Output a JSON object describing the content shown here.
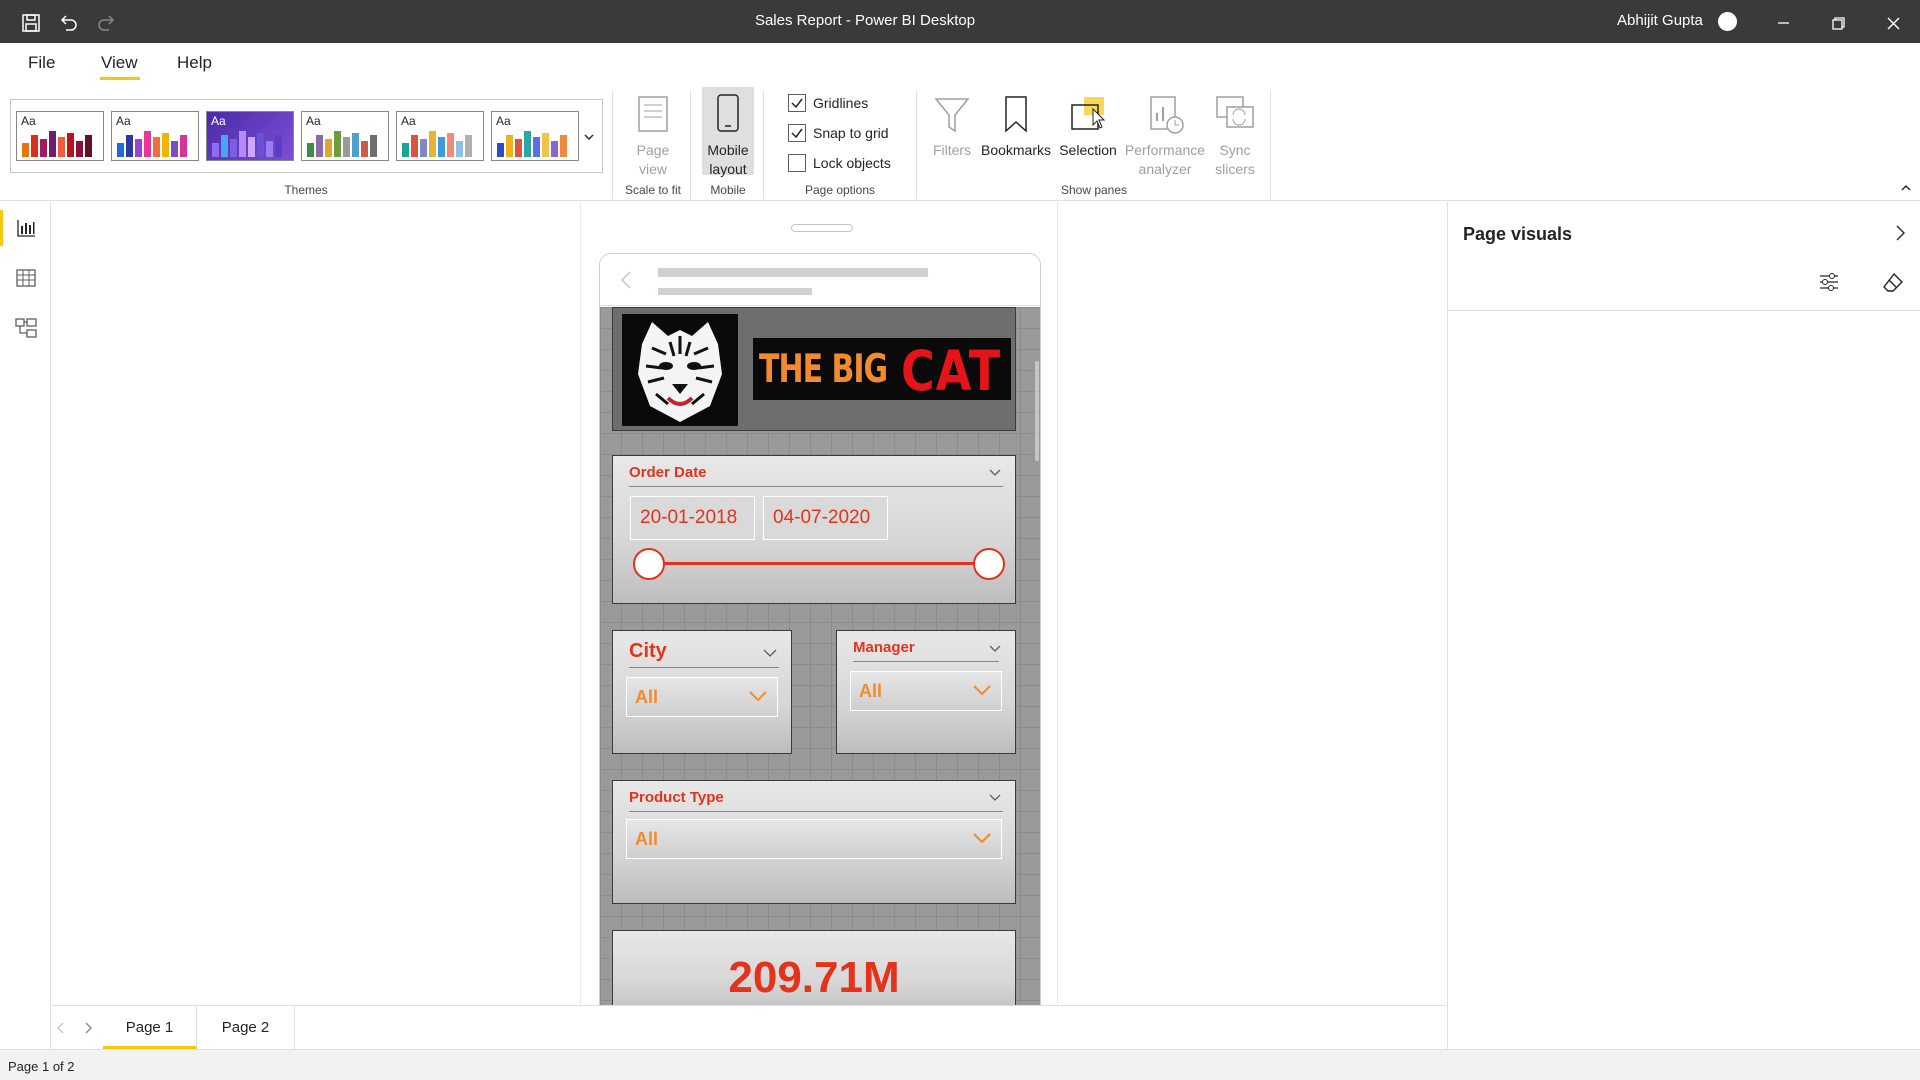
{
  "window": {
    "title": "Sales Report - Power BI Desktop",
    "user": "Abhijit Gupta"
  },
  "menu": {
    "items": [
      "File",
      "View",
      "Help"
    ],
    "active": "View"
  },
  "ribbon": {
    "themes_label": "Themes",
    "themes": [
      {
        "colors": [
          "#e8740c",
          "#d6311b",
          "#a31a5e",
          "#6b1e74",
          "#ee5c3a",
          "#b9131e",
          "#8e1039",
          "#5f1220"
        ]
      },
      {
        "colors": [
          "#1c6ce0",
          "#2a3a9e",
          "#a13fd4",
          "#e8369b",
          "#f16d3c",
          "#f0b400",
          "#7a4cc7",
          "#d6349a"
        ]
      },
      {
        "colors": [
          "#8e6cf0",
          "#4aa4f0",
          "#7c5ee6",
          "#b58af5",
          "#d0a6ff",
          "#6a4fd8",
          "#9b7df2",
          "#5a3ec8"
        ]
      },
      {
        "colors": [
          "#3f8b48",
          "#8b6aa6",
          "#e0a72b",
          "#6f9b3a",
          "#9a9a9a",
          "#4f9fd0",
          "#cc5b4b",
          "#6e6e6e"
        ]
      },
      {
        "colors": [
          "#19a590",
          "#d9553f",
          "#7e88c7",
          "#e2b437",
          "#3d9bd6",
          "#f08a7a",
          "#8dc0e8",
          "#b0b0b0"
        ]
      },
      {
        "colors": [
          "#2b4ec7",
          "#f2b01c",
          "#e0533c",
          "#2aa6a3",
          "#5b6ee6",
          "#f0c44c",
          "#8f63d1",
          "#f08a3a"
        ]
      }
    ],
    "scale_to_fit": {
      "button": "Page view",
      "group": "Scale to fit"
    },
    "mobile": {
      "button": "Mobile layout",
      "group": "Mobile"
    },
    "page_options": {
      "group": "Page options",
      "gridlines": {
        "label": "Gridlines",
        "checked": true
      },
      "snap": {
        "label": "Snap to grid",
        "checked": true
      },
      "lock": {
        "label": "Lock objects",
        "checked": false
      }
    },
    "show_panes": {
      "group": "Show panes",
      "filters": "Filters",
      "bookmarks": "Bookmarks",
      "selection": "Selection",
      "performance": "Performance analyzer",
      "sync": "Sync slicers"
    }
  },
  "report": {
    "banner": {
      "text_white": "THE BIG",
      "text_red": "CAT"
    },
    "order_date": {
      "title": "Order Date",
      "start": "20-01-2018",
      "end": "04-07-2020"
    },
    "city": {
      "title": "City",
      "value": "All"
    },
    "manager": {
      "title": "Manager",
      "value": "All"
    },
    "product_type": {
      "title": "Product Type",
      "value": "All"
    },
    "kpi": {
      "value": "209.71M"
    }
  },
  "right_pane": {
    "title": "Page visuals"
  },
  "pages": {
    "tabs": [
      "Page 1",
      "Page 2"
    ],
    "active": "Page 1"
  },
  "status": {
    "text": "Page 1 of 2"
  },
  "colors": {
    "accent": "#f2c811",
    "slicer_title": "#e3331c",
    "slicer_value": "#f28a2e",
    "titlebar": "#3b3a39"
  }
}
